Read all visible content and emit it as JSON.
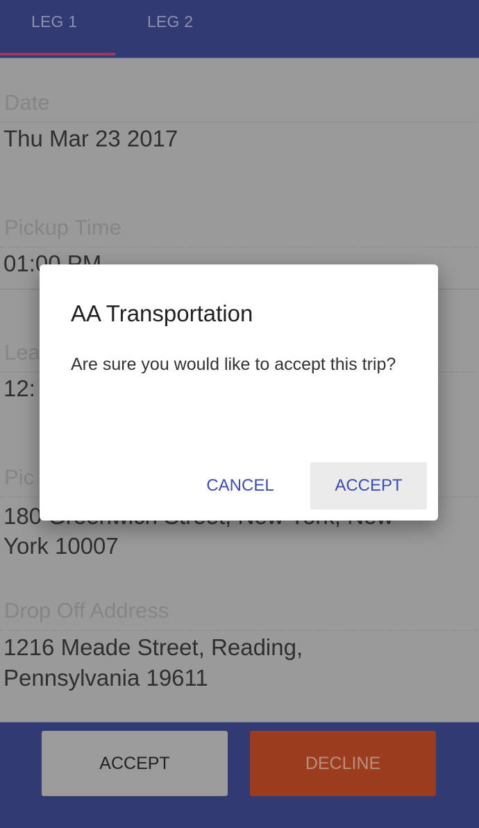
{
  "tabs": [
    {
      "label": "LEG 1",
      "active": true
    },
    {
      "label": "LEG 2",
      "active": false
    }
  ],
  "fields": {
    "date": {
      "label": "Date",
      "value": "Thu Mar 23 2017"
    },
    "pickup_time": {
      "label": "Pickup Time",
      "value": "01:00 PM"
    },
    "leave": {
      "label": "Lea",
      "value": "12:"
    },
    "pickup_address": {
      "label": "Pic",
      "value_line1": "180 Greenwich Street, New York, New",
      "value_line2": "York 10007"
    },
    "dropoff_address": {
      "label": "Drop Off Address",
      "value_line1": "1216 Meade Street, Reading,",
      "value_line2": "Pennsylvania 19611"
    }
  },
  "actions": {
    "accept": "ACCEPT",
    "decline": "DECLINE"
  },
  "dialog": {
    "title": "AA Transportation",
    "message": "Are sure you would like to accept this trip?",
    "cancel": "CANCEL",
    "accept": "ACCEPT"
  },
  "colors": {
    "nav": "#323a73",
    "indicator": "#a2345e",
    "decline": "#9c3d1e",
    "dialog_button": "#3d4cb0"
  }
}
